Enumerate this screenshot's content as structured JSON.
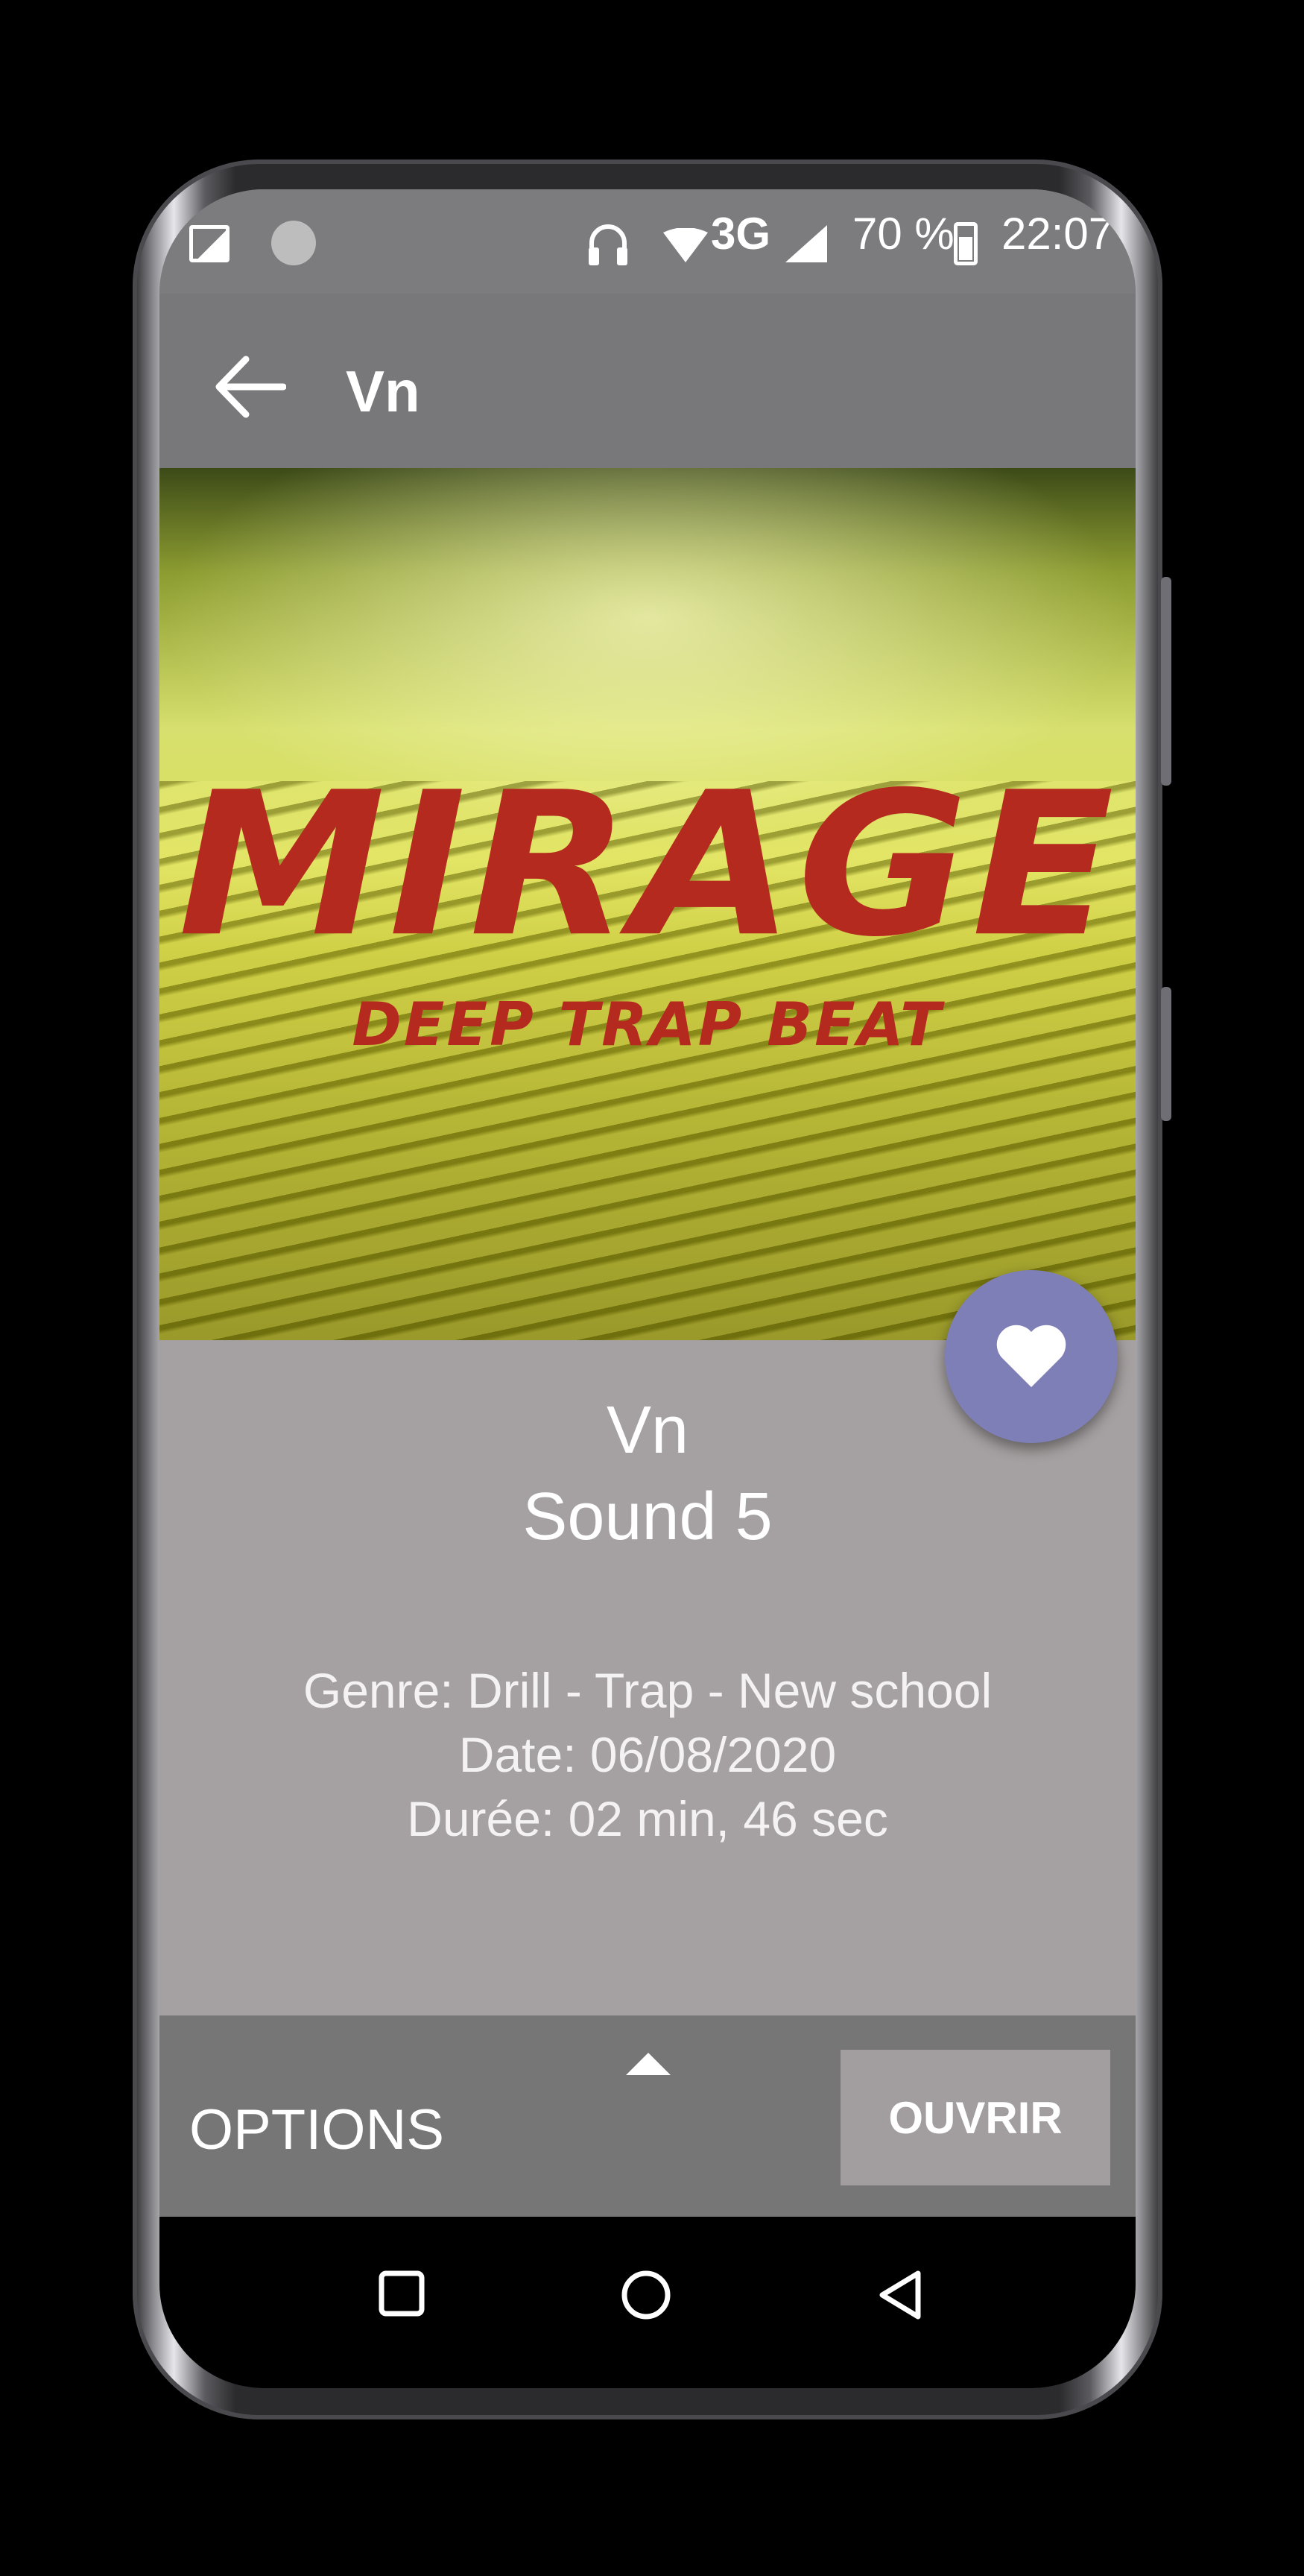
{
  "status_bar": {
    "network": "3G",
    "battery": "70 %",
    "time": "22:07"
  },
  "app_bar": {
    "title": "Vn",
    "back_icon": "arrow-left-icon"
  },
  "cover": {
    "title": "MIRAGE",
    "subtitle": "DEEP TRAP BEAT"
  },
  "track": {
    "artist": "Vn",
    "name": "Sound 5",
    "genre": "Genre: Drill - Trap - New school",
    "date": "Date: 06/08/2020",
    "duration": "Durée: 02 min, 46 sec"
  },
  "favorite": {
    "icon": "heart-icon",
    "color": "#7f7fb7"
  },
  "panel": {
    "options_label": "OPTIONS",
    "open_label": "OUVRIR"
  },
  "nav": {
    "recent": "square-icon",
    "home": "circle-icon",
    "back": "triangle-back-icon"
  }
}
